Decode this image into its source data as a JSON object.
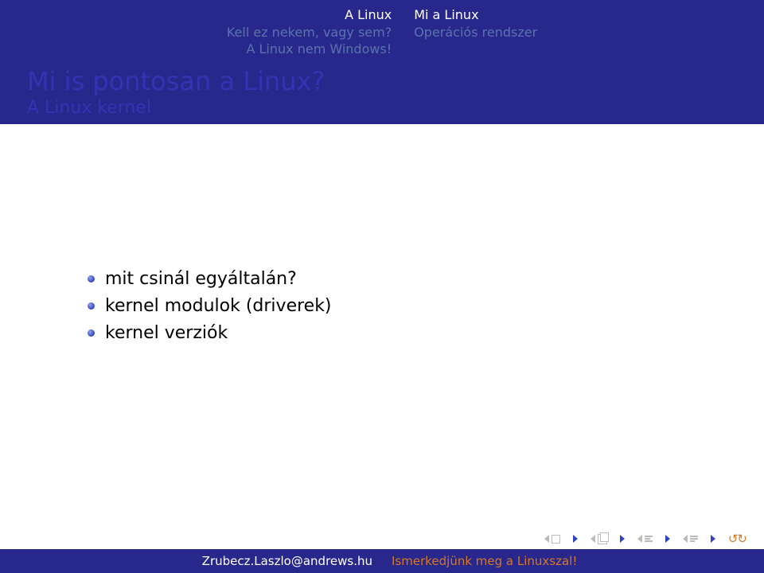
{
  "header": {
    "left": {
      "l1": "A Linux",
      "l2": "Kell ez nekem, vagy sem?",
      "l3": "A Linux nem Windows!"
    },
    "right": {
      "l1": "Mi a Linux",
      "l2": "Operációs rendszer"
    }
  },
  "title": "Mi is pontosan a Linux?",
  "subtitle": "A Linux kernel",
  "bullets": [
    "mit csinál egyáltalán?",
    "kernel modulok (driverek)",
    "kernel verziók"
  ],
  "footer": {
    "author": "Zrubecz.Laszlo@andrews.hu",
    "talk": "Ismerkedjünk meg a Linuxszal!"
  }
}
